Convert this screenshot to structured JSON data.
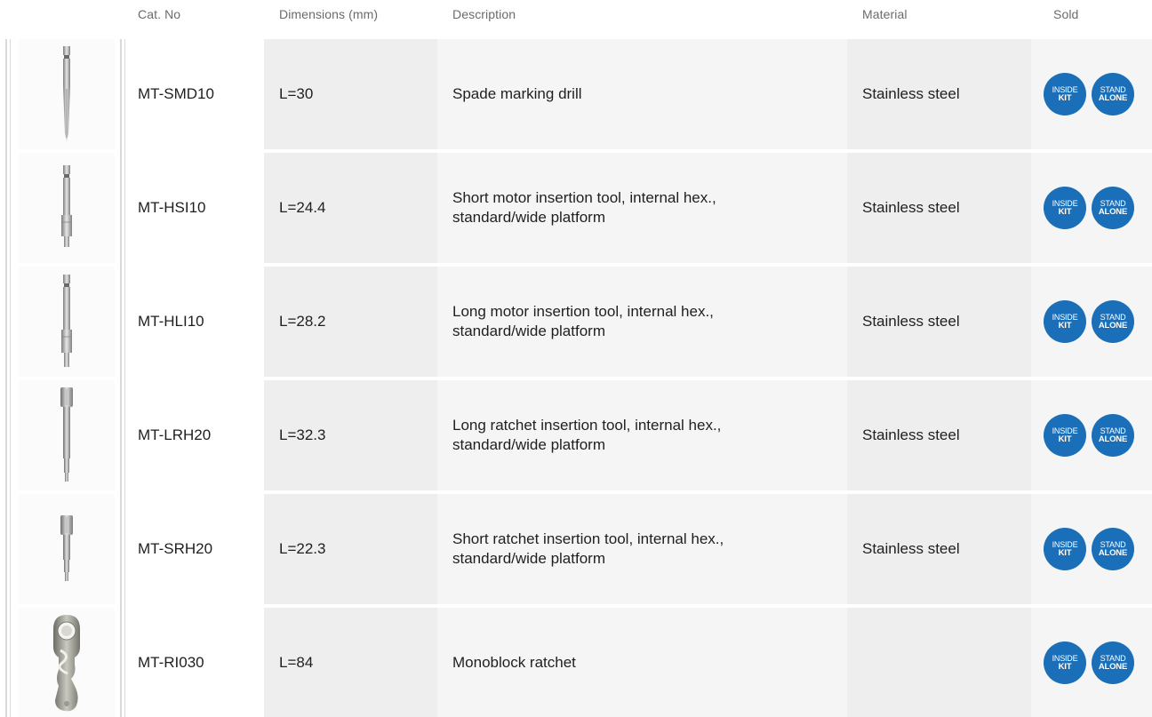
{
  "header": {
    "cat_no": "Cat. No",
    "dimensions": "Dimensions (mm)",
    "description": "Description",
    "material": "Material",
    "sold": "Sold"
  },
  "badges": {
    "inside_line1": "INSIDE",
    "inside_line2": "KIT",
    "stand_line1": "STAND",
    "stand_line2": "ALONE",
    "color": "#1a6fb8"
  },
  "rows": [
    {
      "image": "spade-drill-icon",
      "cat_no": "MT-SMD10",
      "dimensions": "L=30",
      "description": "Spade marking drill",
      "material": "Stainless steel"
    },
    {
      "image": "short-motor-tool-icon",
      "cat_no": "MT-HSI10",
      "dimensions": "L=24.4",
      "description": "Short motor insertion tool,  internal hex.,\nstandard/wide platform",
      "material": "Stainless steel"
    },
    {
      "image": "long-motor-tool-icon",
      "cat_no": "MT-HLI10",
      "dimensions": "L=28.2",
      "description": "Long motor insertion tool,  internal hex.,\nstandard/wide platform",
      "material": "Stainless steel"
    },
    {
      "image": "long-ratchet-tool-icon",
      "cat_no": "MT-LRH20",
      "dimensions": "L=32.3",
      "description": "Long ratchet insertion tool, internal hex.,\nstandard/wide platform",
      "material": "Stainless steel"
    },
    {
      "image": "short-ratchet-tool-icon",
      "cat_no": "MT-SRH20",
      "dimensions": "L=22.3",
      "description": "Short ratchet insertion tool, internal hex.,\nstandard/wide platform",
      "material": "Stainless steel"
    },
    {
      "image": "monoblock-ratchet-icon",
      "cat_no": "MT-RI030",
      "dimensions": "L=84",
      "description": "Monoblock ratchet",
      "material": ""
    }
  ]
}
